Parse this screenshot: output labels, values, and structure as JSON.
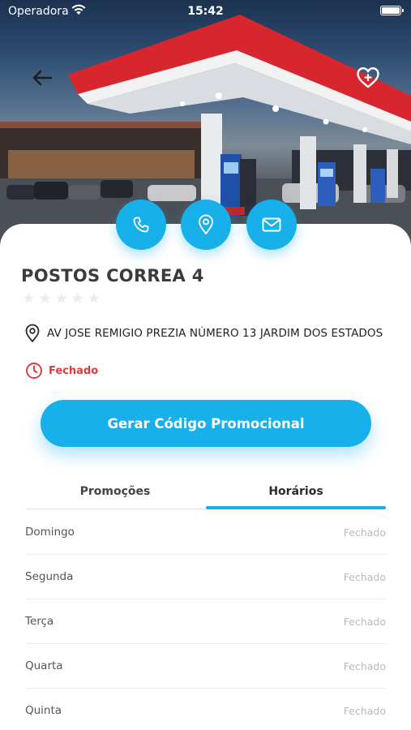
{
  "status_bar": {
    "carrier": "Operadora",
    "time": "15:42"
  },
  "hero": {
    "back_icon": "arrow-left-icon",
    "favorite_icon": "heart-add-icon"
  },
  "actions": [
    {
      "name": "phone",
      "icon": "phone-icon"
    },
    {
      "name": "map",
      "icon": "map-pin-icon"
    },
    {
      "name": "mail",
      "icon": "mail-icon"
    }
  ],
  "station": {
    "name": "POSTOS CORREA 4",
    "rating": 0,
    "rating_max": 5,
    "address": "AV JOSE REMIGIO PREZIA NÚMERO 13 JARDIM DOS ESTADOS",
    "status": "Fechado"
  },
  "promo_button": {
    "label": "Gerar Código Promocional"
  },
  "tabs": [
    {
      "label": "Promoções",
      "active": false
    },
    {
      "label": "Horários",
      "active": true
    }
  ],
  "schedule": [
    {
      "day": "Domingo",
      "hours": "Fechado"
    },
    {
      "day": "Segunda",
      "hours": "Fechado"
    },
    {
      "day": "Terça",
      "hours": "Fechado"
    },
    {
      "day": "Quarta",
      "hours": "Fechado"
    },
    {
      "day": "Quinta",
      "hours": "Fechado"
    }
  ],
  "colors": {
    "accent": "#18b0ea",
    "closed": "#e0383e",
    "canopy_red": "#d8262f"
  }
}
